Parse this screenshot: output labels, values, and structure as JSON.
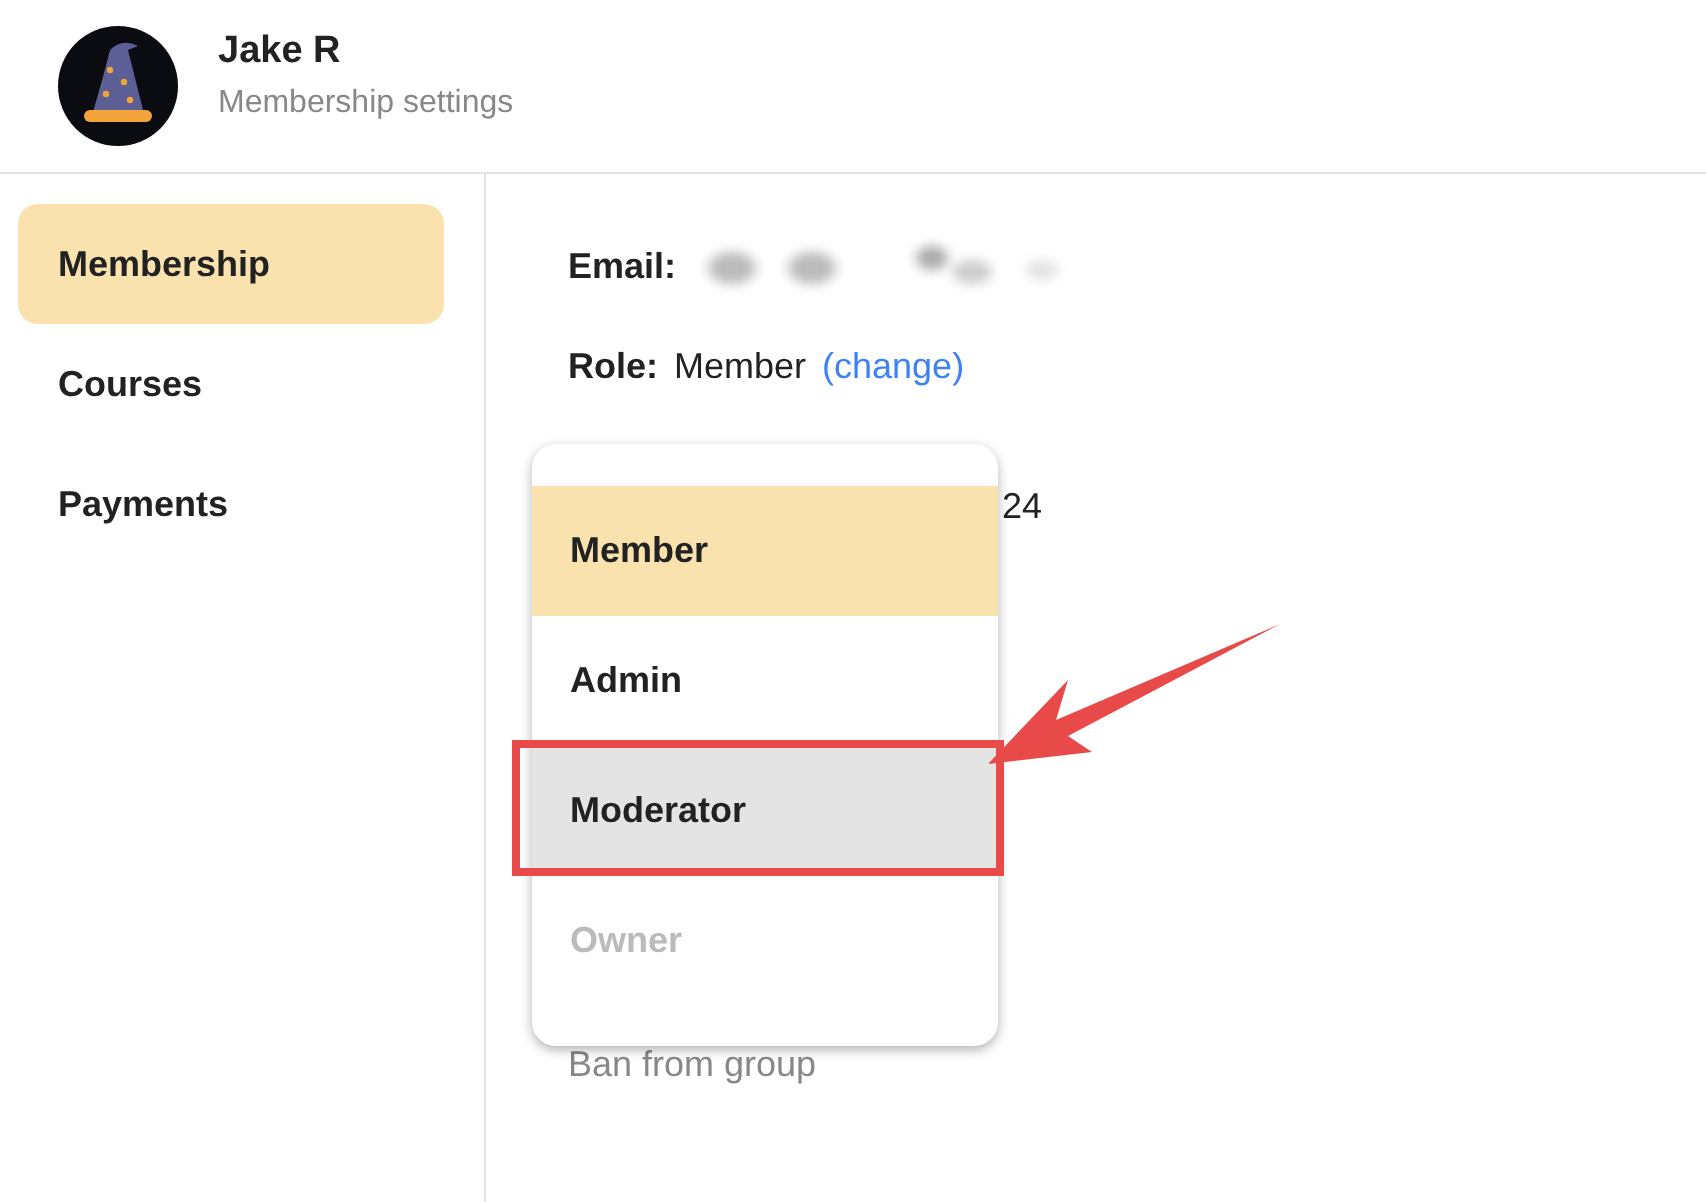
{
  "header": {
    "name": "Jake R",
    "subtitle": "Membership settings"
  },
  "sidebar": {
    "items": [
      {
        "label": "Membership",
        "selected": true
      },
      {
        "label": "Courses",
        "selected": false
      },
      {
        "label": "Payments",
        "selected": false
      }
    ]
  },
  "details": {
    "email_label": "Email:",
    "role_label": "Role:",
    "role_value": "Member",
    "change_link": "(change)",
    "partial_text": "24",
    "ban_link": "Ban from group"
  },
  "role_menu": {
    "items": [
      {
        "label": "Member",
        "selected": true,
        "highlighted": false,
        "disabled": false
      },
      {
        "label": "Admin",
        "selected": false,
        "highlighted": false,
        "disabled": false
      },
      {
        "label": "Moderator",
        "selected": false,
        "highlighted": true,
        "disabled": false
      },
      {
        "label": "Owner",
        "selected": false,
        "highlighted": false,
        "disabled": true
      }
    ]
  }
}
